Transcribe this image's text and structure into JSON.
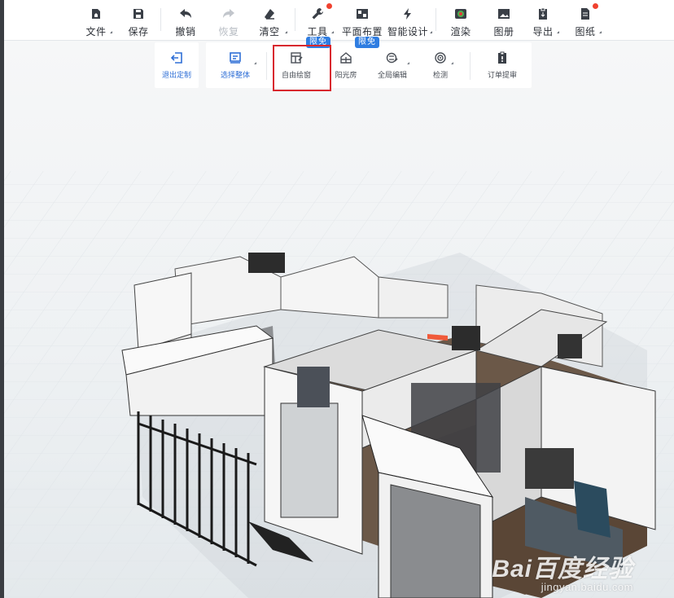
{
  "toolbar": {
    "file": "文件",
    "save": "保存",
    "undo": "撤销",
    "redo": "恢复",
    "clear": "清空",
    "tools": "工具",
    "floor_plan": "平面布置",
    "smart_design": "智能设计",
    "render": "渲染",
    "album": "图册",
    "export": "导出",
    "drawings": "图纸"
  },
  "subtoolbar": {
    "exit_custom": "退出定制",
    "select_whole": "选择整体",
    "free_window": "自由绘窗",
    "sunroom": "阳光房",
    "global_edit": "全局编辑",
    "inspect": "检测",
    "order_review": "订单提审",
    "badge_free_1": "限免",
    "badge_free_2": "限免"
  },
  "watermark": {
    "logo": "Bai百度经验",
    "url": "jingyan.baidu.com"
  },
  "colors": {
    "accent_blue": "#2f7de1",
    "highlight_red": "#d8282e",
    "notice_dot": "#f0412f"
  }
}
